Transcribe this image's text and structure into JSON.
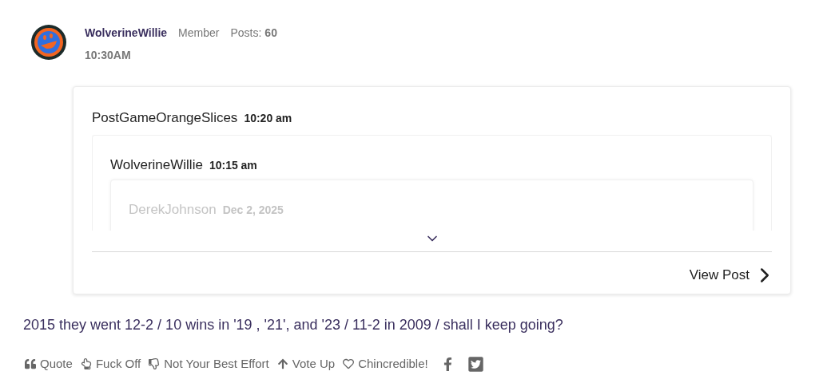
{
  "post": {
    "author": "WolverineWillie",
    "role": "Member",
    "posts_label": "Posts:",
    "posts_count": "60",
    "time": "10:30AM"
  },
  "quote": {
    "author": "PostGameOrangeSlices",
    "time": "10:20 am",
    "view_post": "View Post",
    "nested": {
      "author": "WolverineWillie",
      "time": "10:15 am",
      "nested": {
        "author": "DerekJohnson",
        "time": "Dec 2, 2025"
      }
    }
  },
  "body": "2015 they went 12-2 / 10 wins in '19 , '21', and '23 / 11-2 in 2009 / shall I keep going?",
  "actions": [
    {
      "kind": "quote",
      "label": "Quote"
    },
    {
      "kind": "finger",
      "label": "Fuck Off"
    },
    {
      "kind": "thumbs-down",
      "label": "Not Your Best Effort"
    },
    {
      "kind": "vote-up",
      "label": "Vote Up"
    },
    {
      "kind": "heart",
      "label": "Chincredible!"
    }
  ],
  "share": [
    {
      "kind": "facebook"
    },
    {
      "kind": "twitter"
    }
  ]
}
